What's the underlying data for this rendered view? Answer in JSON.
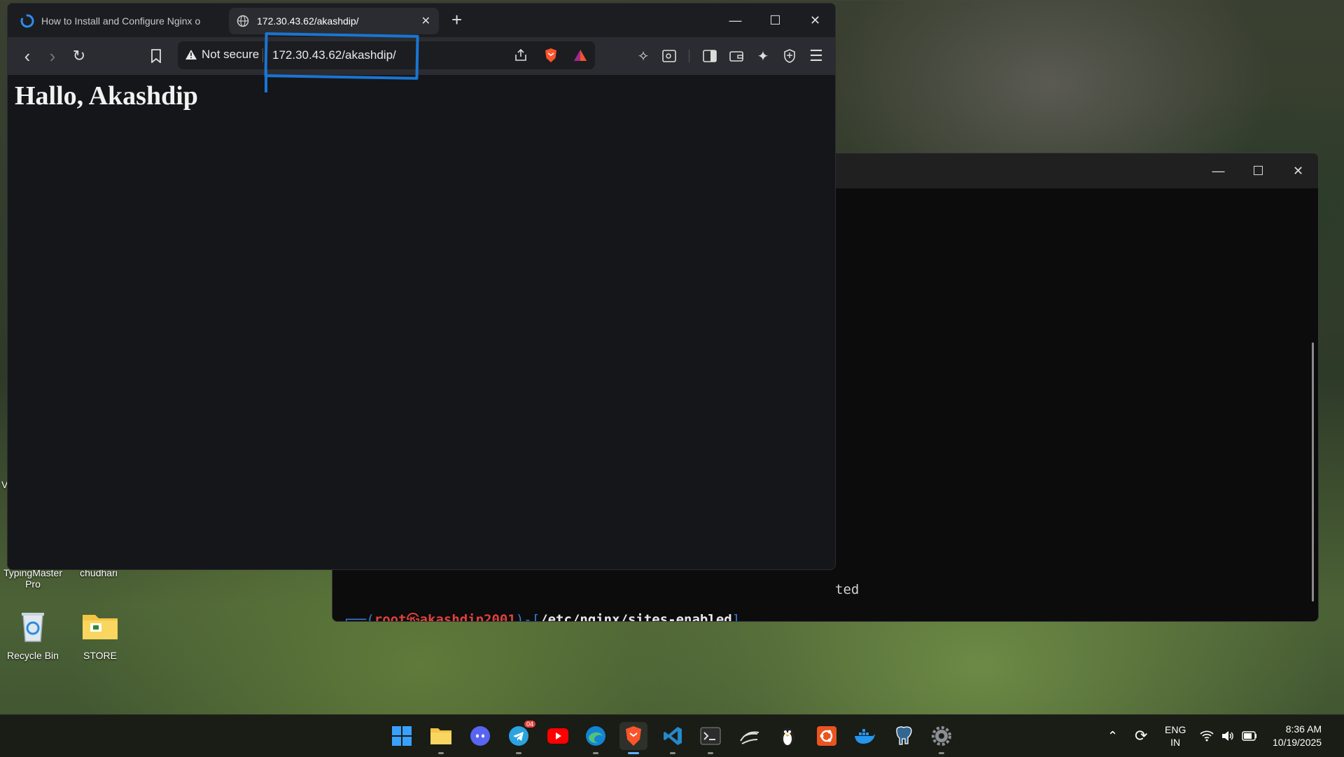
{
  "browser": {
    "tabs": [
      {
        "title": "How to Install and Configure Nginx o",
        "active": false
      },
      {
        "title": "172.30.43.62/akashdip/",
        "active": true
      }
    ],
    "security_label": "Not secure",
    "url": "172.30.43.62/akashdip/",
    "page_heading": "Hallo, Akashdip"
  },
  "terminal": {
    "partial_output": "ted",
    "prompt_user": "root",
    "prompt_at": "㉿",
    "prompt_host": "akashdip2001",
    "prompt_path": "/etc/nginx/sites-enabled",
    "prompt_symbol": "#"
  },
  "desktop": {
    "partial_labels": [
      "TypingMaster Pro",
      "chudhari"
    ],
    "icons": [
      {
        "label": "Recycle Bin"
      },
      {
        "label": "STORE"
      }
    ]
  },
  "taskbar": {
    "telegram_badge": "04",
    "language_line1": "ENG",
    "language_line2": "IN",
    "time": "8:36 AM",
    "date": "10/19/2025"
  },
  "colors": {
    "highlight": "#1a75d2",
    "prompt_red": "#e0413c",
    "prompt_blue": "#3b7ad8"
  }
}
